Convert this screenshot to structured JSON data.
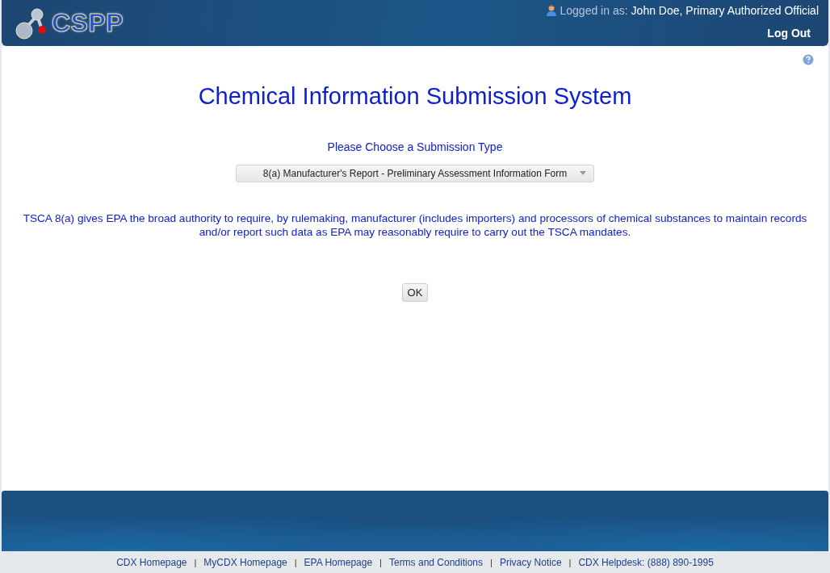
{
  "header": {
    "logo_text": "CSPP",
    "login_label": "Logged in as:",
    "user": "John Doe, Primary Authorized Official",
    "logout": "Log Out"
  },
  "main": {
    "title": "Chemical Information Submission System",
    "prompt": "Please Choose a Submission Type",
    "select": {
      "value": "8(a) Manufacturer's Report - Preliminary Assessment Information Form"
    },
    "description": "TSCA 8(a) gives EPA the broad authority to require, by rulemaking, manufacturer (includes importers) and processors of chemical substances to maintain records and/or report such data as EPA may reasonably require to carry out the TSCA mandates.",
    "ok_button": "OK"
  },
  "footer_links": [
    {
      "kind": "link",
      "text": "CDX Homepage"
    },
    {
      "kind": "separator",
      "text": "|"
    },
    {
      "kind": "link",
      "text": "MyCDX Homepage"
    },
    {
      "kind": "separator",
      "text": "|"
    },
    {
      "kind": "link",
      "text": "EPA Homepage"
    },
    {
      "kind": "separator",
      "text": "|"
    },
    {
      "kind": "link",
      "text": "Terms and Conditions"
    },
    {
      "kind": "separator",
      "text": "|"
    },
    {
      "kind": "link",
      "text": "Privacy Notice"
    },
    {
      "kind": "separator",
      "text": "|"
    },
    {
      "kind": "link",
      "text": "CDX Helpdesk: (888) 890-1995"
    }
  ]
}
